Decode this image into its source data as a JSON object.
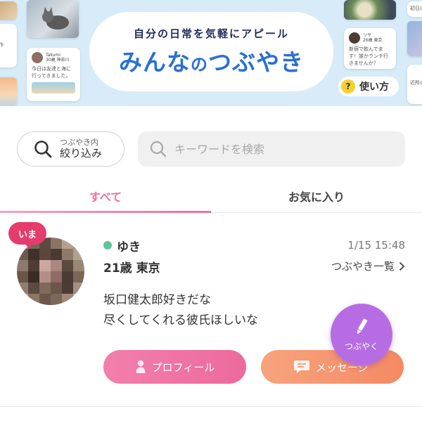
{
  "banner": {
    "subtitle": "自分の日常を気軽にアピール",
    "title_part1": "みんな",
    "title_part2": "の",
    "title_part3": "つぶやき",
    "howto_icon": "?",
    "howto_label": "使い方",
    "card_left": {
      "name": "Takumi",
      "meta": "30歳 神奈川",
      "text": "今日は友達と海に行ってきました。"
    },
    "card_right": {
      "name": "リサ",
      "meta": "26歳 東京",
      "text": "新宿で飲んでます！誰かランチ行きませんか？"
    },
    "card_edge_left": "毎日を作",
    "card_edge_right": "初日は",
    "card_edge_right2": "近所の"
  },
  "filter": {
    "line1": "つぶやき内",
    "line2": "絞り込み"
  },
  "search": {
    "placeholder": "キーワードを検索"
  },
  "tabs": [
    {
      "label": "すべて",
      "active": true
    },
    {
      "label": "お気に入り",
      "active": false
    }
  ],
  "post": {
    "badge": "いま",
    "username": "ゆき",
    "age_location": "21歳 東京",
    "timestamp": "1/15 15:48",
    "list_link": "つぶやき一覧",
    "text_line1": "坂口健太郎好きだな",
    "text_line2": "尽くしてくれる彼氏ほしいな",
    "profile_button": "プロフィール",
    "message_button": "メッセージ",
    "online_color": "#5ec39a"
  },
  "fab": {
    "label": "つぶやく",
    "icon": "pencil-icon"
  },
  "colors": {
    "accent_pink": "#ec6fa0",
    "accent_orange": "#f48a63",
    "accent_purple": "#b66de4",
    "title_blue": "#2b6fd6"
  }
}
